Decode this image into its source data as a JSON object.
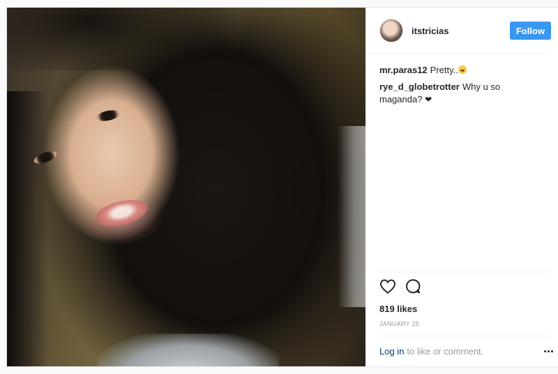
{
  "post": {
    "author": {
      "username": "itstricias",
      "follow_label": "Follow"
    },
    "comments": [
      {
        "author": "mr.paras12",
        "text": "Pretty..",
        "emoji": "grinning-squinting-face"
      },
      {
        "author": "rye_d_globetrotter",
        "text": "Why u so maganda? ",
        "emoji": "black-heart"
      }
    ],
    "heart_glyph": "❤",
    "likes": "819 likes",
    "date": "JANUARY 25",
    "footer": {
      "login_label": "Log in",
      "prompt": "to like or comment."
    },
    "icons": [
      "heart-icon",
      "comment-icon",
      "more-options-icon"
    ],
    "colors": {
      "accent": "#3897f0",
      "link": "#003569",
      "muted": "#999999"
    }
  }
}
